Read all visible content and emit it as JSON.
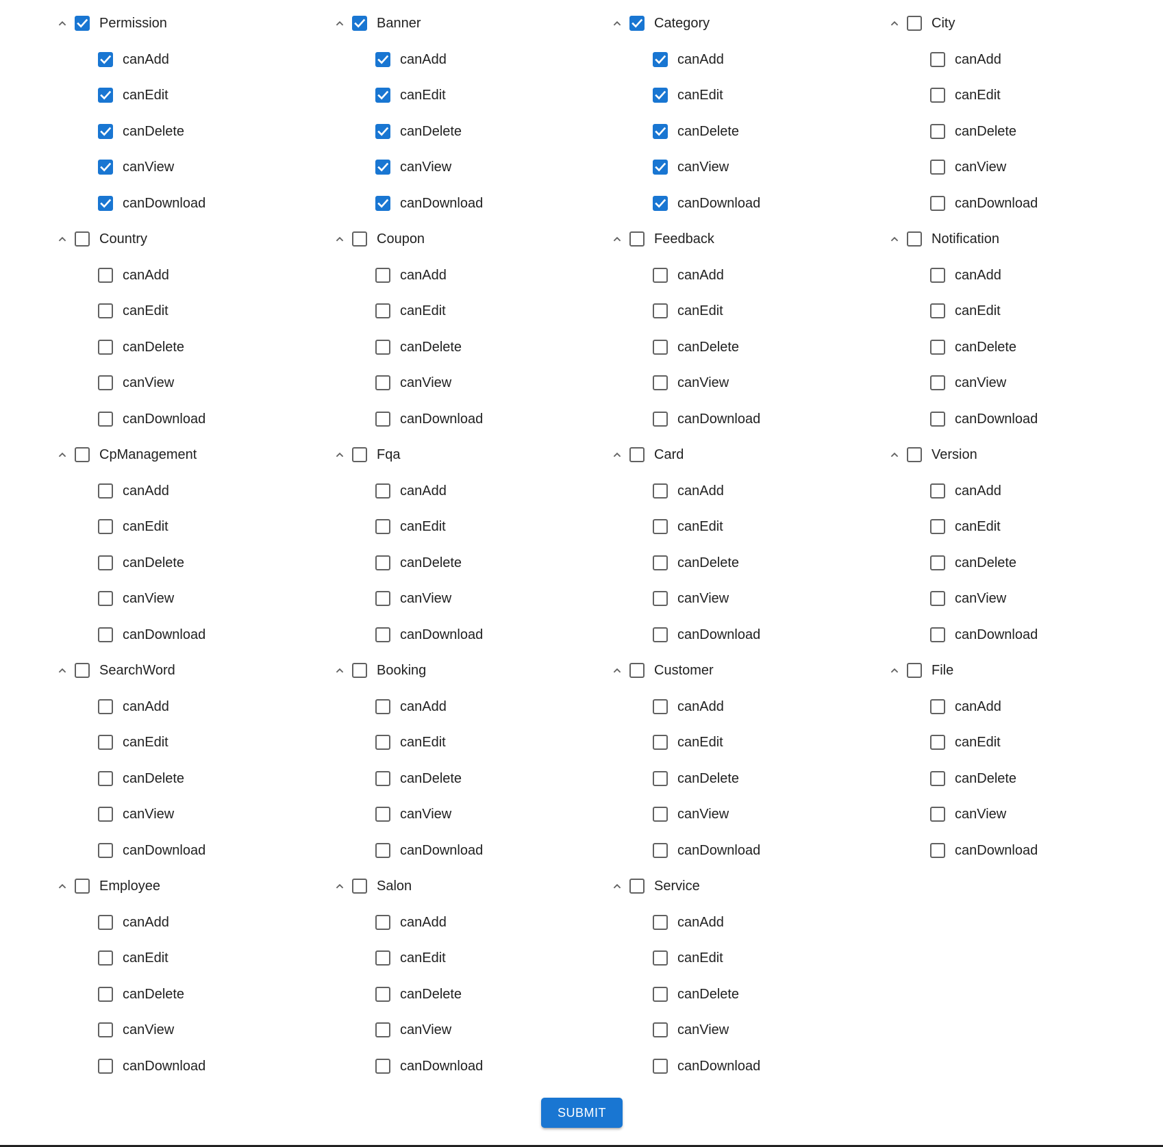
{
  "accent_color": "#1976d2",
  "perm_labels": [
    "canAdd",
    "canEdit",
    "canDelete",
    "canView",
    "canDownload"
  ],
  "groups": [
    {
      "name": "Permission",
      "checked": true,
      "perms": [
        true,
        true,
        true,
        true,
        true
      ]
    },
    {
      "name": "Banner",
      "checked": true,
      "perms": [
        true,
        true,
        true,
        true,
        true
      ]
    },
    {
      "name": "Category",
      "checked": true,
      "perms": [
        true,
        true,
        true,
        true,
        true
      ]
    },
    {
      "name": "City",
      "checked": false,
      "perms": [
        false,
        false,
        false,
        false,
        false
      ]
    },
    {
      "name": "Country",
      "checked": false,
      "perms": [
        false,
        false,
        false,
        false,
        false
      ]
    },
    {
      "name": "Coupon",
      "checked": false,
      "perms": [
        false,
        false,
        false,
        false,
        false
      ]
    },
    {
      "name": "Feedback",
      "checked": false,
      "perms": [
        false,
        false,
        false,
        false,
        false
      ]
    },
    {
      "name": "Notification",
      "checked": false,
      "perms": [
        false,
        false,
        false,
        false,
        false
      ]
    },
    {
      "name": "CpManagement",
      "checked": false,
      "perms": [
        false,
        false,
        false,
        false,
        false
      ]
    },
    {
      "name": "Fqa",
      "checked": false,
      "perms": [
        false,
        false,
        false,
        false,
        false
      ]
    },
    {
      "name": "Card",
      "checked": false,
      "perms": [
        false,
        false,
        false,
        false,
        false
      ]
    },
    {
      "name": "Version",
      "checked": false,
      "perms": [
        false,
        false,
        false,
        false,
        false
      ]
    },
    {
      "name": "SearchWord",
      "checked": false,
      "perms": [
        false,
        false,
        false,
        false,
        false
      ]
    },
    {
      "name": "Booking",
      "checked": false,
      "perms": [
        false,
        false,
        false,
        false,
        false
      ]
    },
    {
      "name": "Customer",
      "checked": false,
      "perms": [
        false,
        false,
        false,
        false,
        false
      ]
    },
    {
      "name": "File",
      "checked": false,
      "perms": [
        false,
        false,
        false,
        false,
        false
      ]
    },
    {
      "name": "Employee",
      "checked": false,
      "perms": [
        false,
        false,
        false,
        false,
        false
      ]
    },
    {
      "name": "Salon",
      "checked": false,
      "perms": [
        false,
        false,
        false,
        false,
        false
      ]
    },
    {
      "name": "Service",
      "checked": false,
      "perms": [
        false,
        false,
        false,
        false,
        false
      ]
    }
  ],
  "submit_label": "SUBMIT"
}
